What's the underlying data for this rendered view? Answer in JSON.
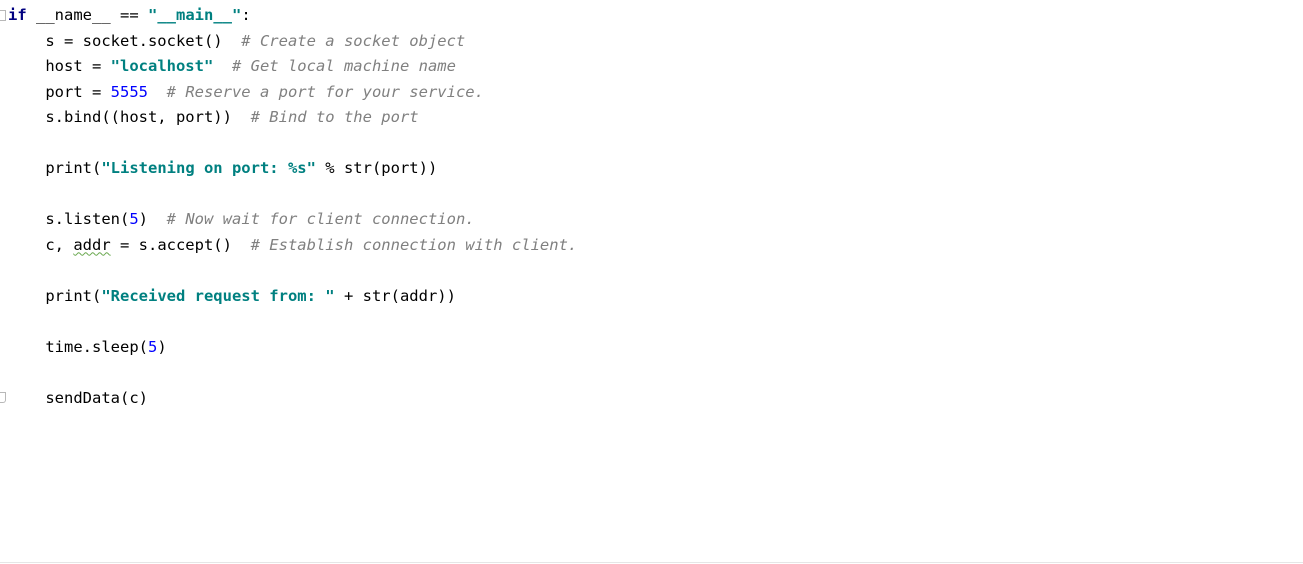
{
  "editor": {
    "lines": {
      "l1": {
        "kw": "if",
        "a": " __name__ == ",
        "s": "\"__main__\"",
        "b": ":"
      },
      "l2": {
        "code": "    s = socket.socket()  ",
        "comment": "# Create a socket object"
      },
      "l3": {
        "a": "    host = ",
        "s": "\"localhost\"",
        "b": "  ",
        "comment": "# Get local machine name"
      },
      "l4": {
        "a": "    port = ",
        "num": "5555",
        "b": "  ",
        "comment": "# Reserve a port for your service."
      },
      "l5": {
        "code": "    s.bind((host, port))  ",
        "comment": "# Bind to the port"
      },
      "l7": {
        "a": "    print(",
        "s": "\"Listening on port: %s\"",
        "b": " % str(port))"
      },
      "l9": {
        "a": "    s.listen(",
        "num": "5",
        "b": ")  ",
        "comment": "# Now wait for client connection."
      },
      "l10": {
        "a": "    c, ",
        "squiggle": "addr",
        "b": " = s.accept()  ",
        "comment": "# Establish connection with client."
      },
      "l12": {
        "a": "    print(",
        "s": "\"Received request from: \"",
        "b": " + str(addr))"
      },
      "l14": {
        "a": "    time.sleep(",
        "num": "5",
        "b": ")"
      },
      "l16": {
        "code": "    sendData(c)"
      }
    }
  }
}
